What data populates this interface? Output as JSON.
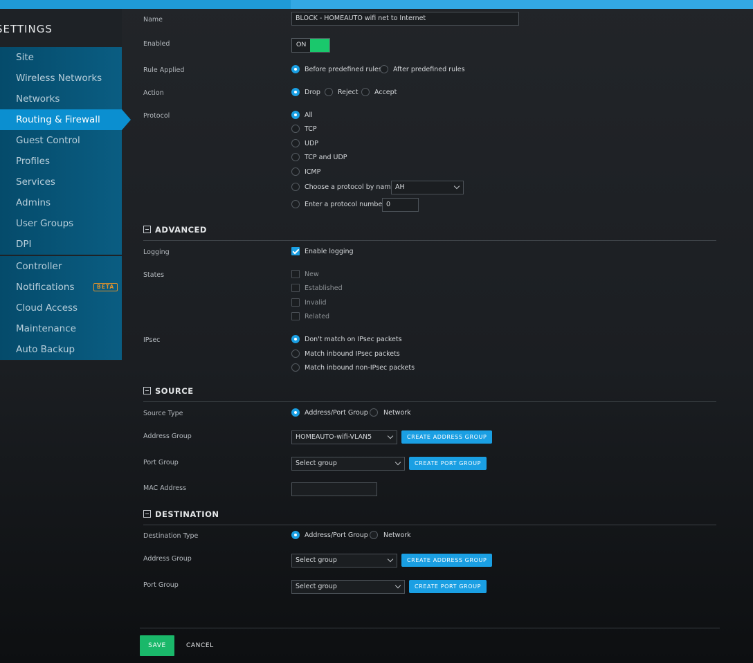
{
  "sidebar": {
    "title": "SETTINGS",
    "group1": [
      {
        "label": "Site"
      },
      {
        "label": "Wireless Networks"
      },
      {
        "label": "Networks"
      },
      {
        "label": "Routing & Firewall",
        "active": true
      },
      {
        "label": "Guest Control"
      },
      {
        "label": "Profiles"
      },
      {
        "label": "Services"
      },
      {
        "label": "Admins"
      },
      {
        "label": "User Groups"
      },
      {
        "label": "DPI"
      }
    ],
    "group2": [
      {
        "label": "Controller"
      },
      {
        "label": "Notifications",
        "badge": "BETA"
      },
      {
        "label": "Cloud Access"
      },
      {
        "label": "Maintenance"
      },
      {
        "label": "Auto Backup"
      }
    ]
  },
  "form": {
    "name": {
      "label": "Name",
      "value": "BLOCK - HOMEAUTO wifi net to Internet"
    },
    "enabled": {
      "label": "Enabled",
      "state": "ON"
    },
    "rule_applied": {
      "label": "Rule Applied",
      "options": [
        "Before predefined rules",
        "After predefined rules"
      ],
      "selected": 0
    },
    "action": {
      "label": "Action",
      "options": [
        "Drop",
        "Reject",
        "Accept"
      ],
      "selected": 0
    },
    "protocol": {
      "label": "Protocol",
      "options": [
        "All",
        "TCP",
        "UDP",
        "TCP and UDP",
        "ICMP",
        "Choose a protocol by name",
        "Enter a protocol number"
      ],
      "selected": 0,
      "by_name_value": "AH",
      "number_value": "0"
    }
  },
  "advanced": {
    "title": "ADVANCED",
    "logging": {
      "label": "Logging",
      "option": "Enable logging",
      "checked": true
    },
    "states": {
      "label": "States",
      "options": [
        "New",
        "Established",
        "Invalid",
        "Related"
      ]
    },
    "ipsec": {
      "label": "IPsec",
      "options": [
        "Don't match on IPsec packets",
        "Match inbound IPsec packets",
        "Match inbound non-IPsec packets"
      ],
      "selected": 0
    }
  },
  "source": {
    "title": "SOURCE",
    "type": {
      "label": "Source Type",
      "options": [
        "Address/Port Group",
        "Network"
      ],
      "selected": 0
    },
    "address_group": {
      "label": "Address Group",
      "value": "HOMEAUTO-wifi-VLAN5",
      "button": "CREATE ADDRESS GROUP"
    },
    "port_group": {
      "label": "Port Group",
      "value": "Select group",
      "button": "CREATE PORT GROUP"
    },
    "mac": {
      "label": "MAC Address",
      "value": ""
    }
  },
  "destination": {
    "title": "DESTINATION",
    "type": {
      "label": "Destination Type",
      "options": [
        "Address/Port Group",
        "Network"
      ],
      "selected": 0
    },
    "address_group": {
      "label": "Address Group",
      "value": "Select group",
      "button": "CREATE ADDRESS GROUP"
    },
    "port_group": {
      "label": "Port Group",
      "value": "Select group",
      "button": "CREATE PORT GROUP"
    }
  },
  "footer": {
    "save": "SAVE",
    "cancel": "CANCEL"
  },
  "colors": {
    "accent": "#1a9fe3",
    "toggle_on": "#1ac86c",
    "save": "#1ab86a",
    "beta": "#e0922c"
  },
  "icons": {
    "section_toggle": "collapse-minus-icon",
    "dropdown": "chevron-down-icon",
    "check": "checkmark-icon"
  }
}
